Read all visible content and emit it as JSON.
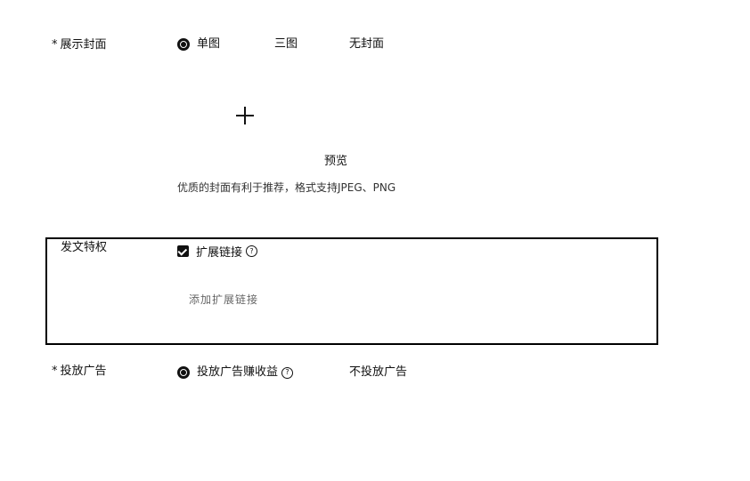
{
  "cover": {
    "required_mark": "*",
    "label": "展示封面",
    "options": [
      "单图",
      "三图",
      "无封面"
    ],
    "selected": "单图",
    "upload_icon": "plus-icon",
    "preview_label": "预览",
    "hint": "优质的封面有利于推荐，格式支持JPEG、PNG"
  },
  "privilege": {
    "label": "发文特权",
    "checkbox_label": "扩展链接",
    "checkbox_checked": true,
    "info_symbol": "?",
    "sub_text": "添加扩展链接"
  },
  "ads": {
    "required_mark": "*",
    "label": "投放广告",
    "options": [
      "投放广告赚收益",
      "不投放广告"
    ],
    "selected": "投放广告赚收益",
    "info_symbol": "?"
  }
}
